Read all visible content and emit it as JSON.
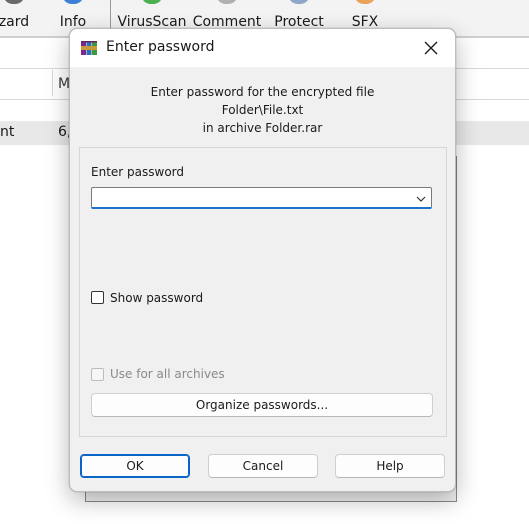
{
  "background_app": {
    "toolbar": [
      {
        "label": "zard",
        "icon": "wizard-icon"
      },
      {
        "label": "Info",
        "icon": "info-icon"
      },
      {
        "label": "VirusScan",
        "icon": "virusscan-icon"
      },
      {
        "label": "Comment",
        "icon": "comment-icon"
      },
      {
        "label": "Protect",
        "icon": "protect-icon"
      },
      {
        "label": "SFX",
        "icon": "sfx-icon"
      }
    ],
    "list_header": {
      "col2": "M"
    },
    "list_row": {
      "name": "nt",
      "size": "6,"
    }
  },
  "dialog": {
    "title": "Enter password",
    "title_icon": "winrar-icon",
    "close_icon": "close-icon",
    "message": {
      "line1": "Enter password for the encrypted file",
      "line2": "Folder\\File.txt",
      "line3": "in archive Folder.rar"
    },
    "password_label": "Enter password",
    "password_value": "",
    "password_placeholder": "",
    "show_password_label": "Show password",
    "show_password_checked": false,
    "use_for_all_label": "Use for all archives",
    "use_for_all_checked": false,
    "use_for_all_enabled": false,
    "organize_label": "Organize passwords...",
    "buttons": {
      "ok": "OK",
      "cancel": "Cancel",
      "help": "Help"
    },
    "accent_color": "#0a64c8"
  }
}
